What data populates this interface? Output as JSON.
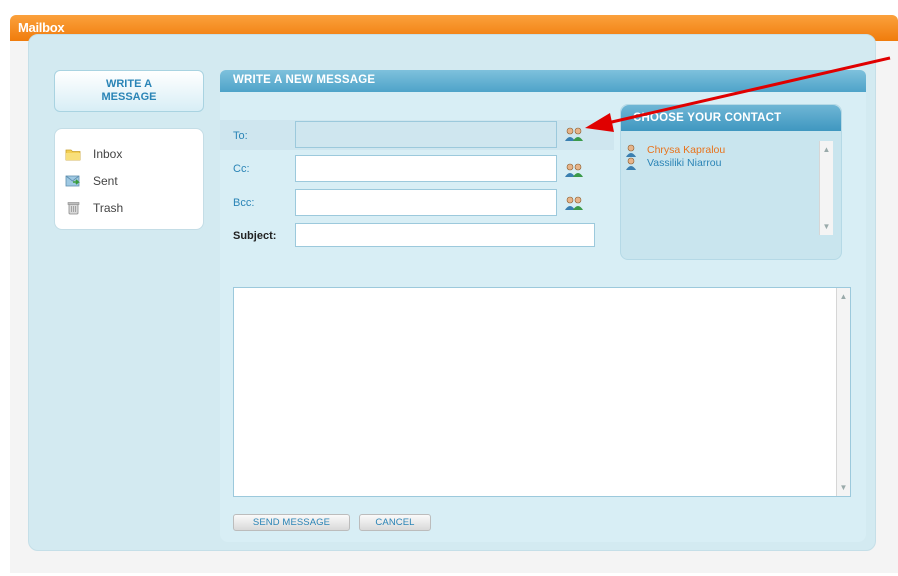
{
  "window": {
    "title": "Mailbox"
  },
  "sidebar": {
    "write_button": "WRITE A\nMESSAGE",
    "folders": [
      {
        "label": "Inbox",
        "icon": "folder-icon"
      },
      {
        "label": "Sent",
        "icon": "sent-icon"
      },
      {
        "label": "Trash",
        "icon": "trash-icon"
      }
    ]
  },
  "compose": {
    "header": "WRITE A NEW MESSAGE",
    "fields": {
      "to": {
        "label": "To:",
        "value": ""
      },
      "cc": {
        "label": "Cc:",
        "value": ""
      },
      "bcc": {
        "label": "Bcc:",
        "value": ""
      },
      "subject": {
        "label": "Subject:",
        "value": ""
      }
    },
    "body": "",
    "buttons": {
      "send": "SEND MESSAGE",
      "cancel": "CANCEL"
    }
  },
  "contacts": {
    "header": "CHOOSE YOUR CONTACT",
    "items": [
      {
        "name": "Chrysa Kapralou",
        "color": "#e8731c"
      },
      {
        "name": "Vassiliki Niarrou",
        "color": "#2a84b6"
      }
    ]
  },
  "colors": {
    "titlebar": "#f07c0c",
    "panel": "#d3eaf1",
    "header": "#4ea3c9",
    "annotation_arrow": "#e00000"
  }
}
